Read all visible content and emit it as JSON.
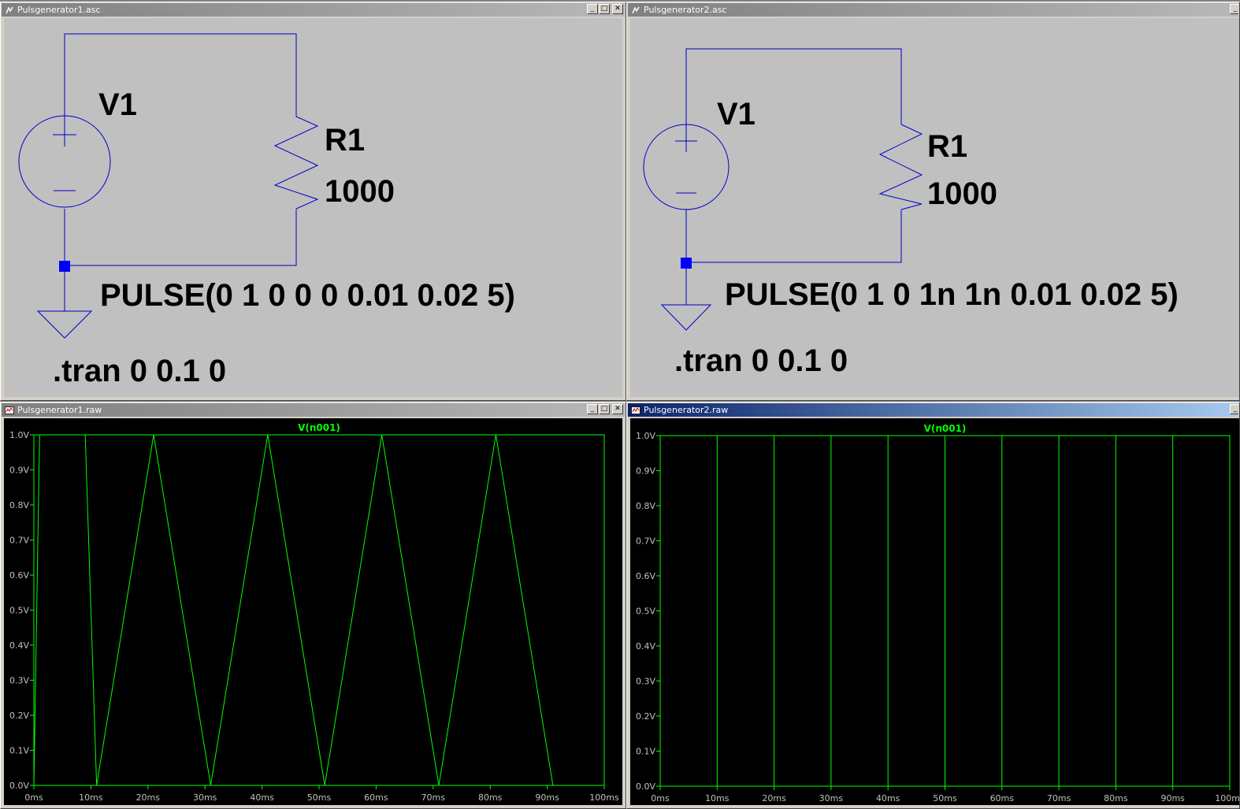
{
  "windows": {
    "sch1": {
      "title": "Pulsgenerator1.asc"
    },
    "sch2": {
      "title": "Pulsgenerator2.asc"
    },
    "plot1": {
      "title": "Pulsgenerator1.raw"
    },
    "plot2": {
      "title": "Pulsgenerator2.raw"
    }
  },
  "schematic1": {
    "source_name": "V1",
    "resistor_name": "R1",
    "resistor_value": "1000",
    "source_value": "PULSE(0 1 0 0 0 0.01 0.02 5)",
    "directive": ".tran 0 0.1 0"
  },
  "schematic2": {
    "source_name": "V1",
    "resistor_name": "R1",
    "resistor_value": "1000",
    "source_value": "PULSE(0 1 0 1n 1n 0.01 0.02 5)",
    "directive": ".tran 0 0.1 0"
  },
  "colors": {
    "schematic_bg": "#c0c0c0",
    "wire": "#0000c8",
    "plot_bg": "#000000",
    "trace": "#00ff00",
    "grid_frame": "#00ff00"
  },
  "icons": {
    "schematic_window": "schematic-window-icon",
    "waveform_window": "waveform-window-icon",
    "minimize": "minimize-icon",
    "maximize": "maximize-icon",
    "close": "close-icon"
  },
  "chart_data": [
    {
      "type": "line",
      "title": "V(n001)",
      "xlim": [
        0,
        100
      ],
      "ylim": [
        0,
        1
      ],
      "x_ticks": [
        "0ms",
        "10ms",
        "20ms",
        "30ms",
        "40ms",
        "50ms",
        "60ms",
        "70ms",
        "80ms",
        "90ms",
        "100ms"
      ],
      "y_ticks": [
        "0.0V",
        "0.1V",
        "0.2V",
        "0.3V",
        "0.4V",
        "0.5V",
        "0.6V",
        "0.7V",
        "0.8V",
        "0.9V",
        "1.0V"
      ],
      "series": [
        {
          "name": "V(n001)",
          "x": [
            0,
            1,
            9,
            11,
            21,
            31,
            41,
            51,
            61,
            71,
            81,
            91
          ],
          "y": [
            0,
            1,
            1,
            0,
            1,
            0,
            1,
            0,
            1,
            0,
            1,
            0
          ]
        }
      ]
    },
    {
      "type": "line",
      "title": "V(n001)",
      "xlim": [
        0,
        100
      ],
      "ylim": [
        0,
        1
      ],
      "x_ticks": [
        "0ms",
        "10ms",
        "20ms",
        "30ms",
        "40ms",
        "50ms",
        "60ms",
        "70ms",
        "80ms",
        "90ms",
        "100ms"
      ],
      "y_ticks": [
        "0.0V",
        "0.1V",
        "0.2V",
        "0.3V",
        "0.4V",
        "0.5V",
        "0.6V",
        "0.7V",
        "0.8V",
        "0.9V",
        "1.0V"
      ],
      "series": [
        {
          "name": "V(n001)",
          "x": [
            0,
            0,
            10,
            10,
            20,
            20,
            30,
            30,
            40,
            40,
            50,
            50,
            60,
            60,
            70,
            70,
            80,
            80,
            90,
            90,
            100
          ],
          "y": [
            0,
            1,
            1,
            0,
            0,
            1,
            1,
            0,
            0,
            1,
            1,
            0,
            0,
            1,
            1,
            0,
            0,
            1,
            1,
            0,
            0
          ]
        }
      ]
    }
  ]
}
